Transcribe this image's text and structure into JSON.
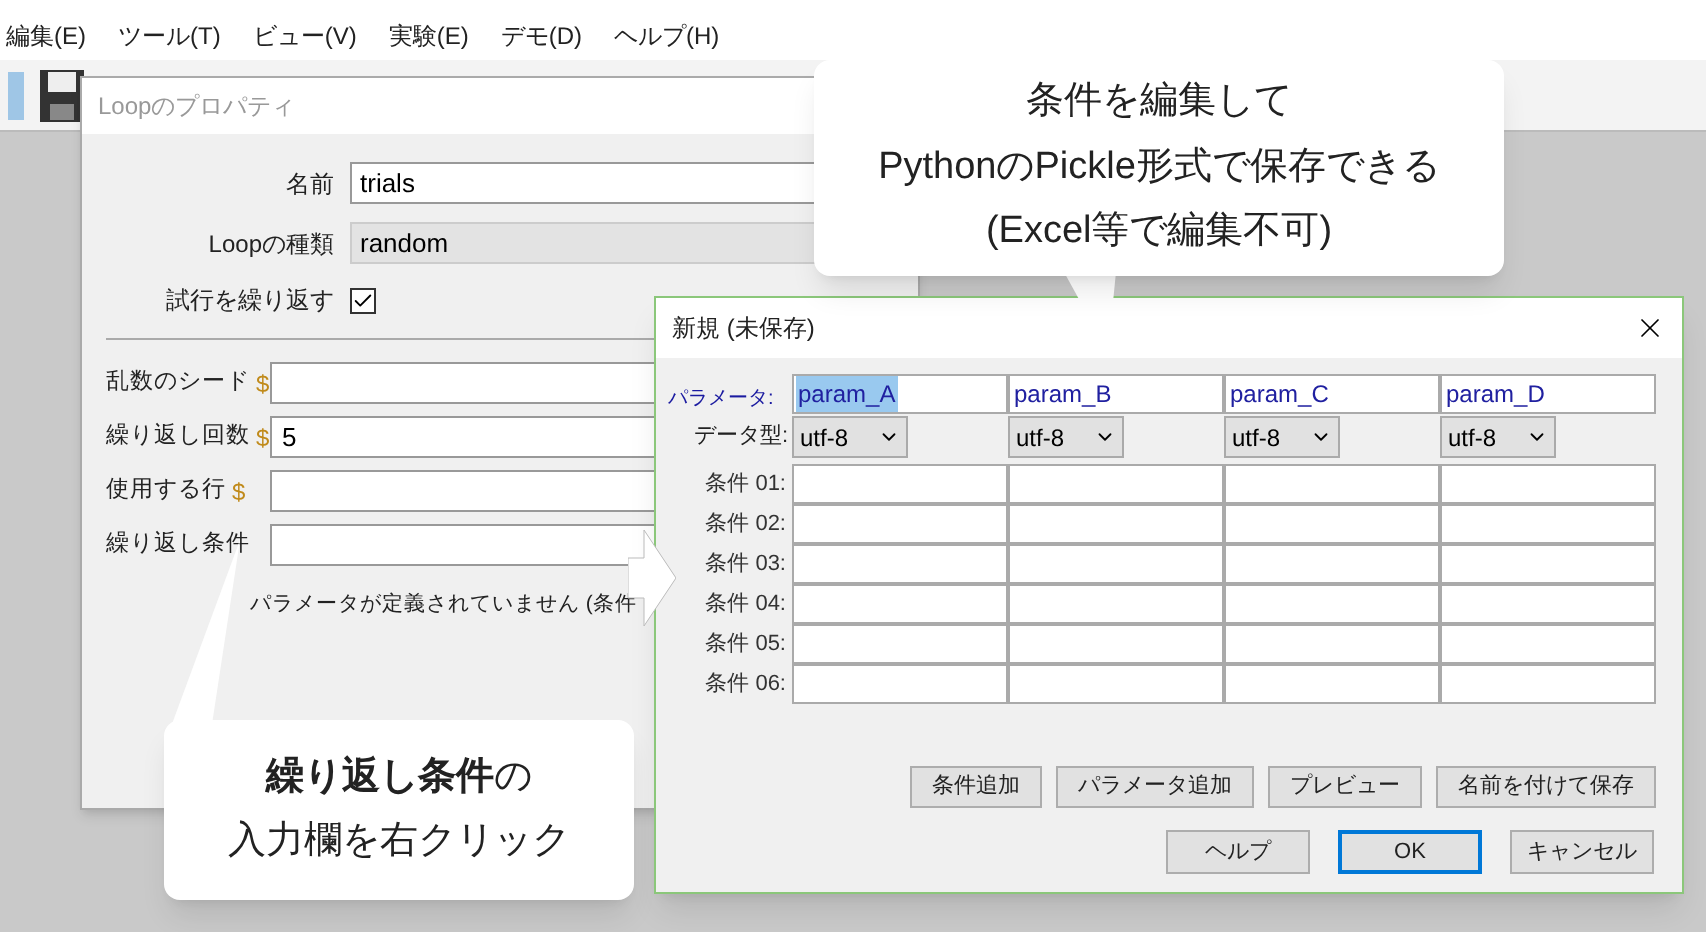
{
  "menu": [
    "編集(E)",
    "ツール(T)",
    "ビュー(V)",
    "実験(E)",
    "デモ(D)",
    "ヘルプ(H)"
  ],
  "loop_window": {
    "title": "Loopのプロパティ",
    "fields": [
      {
        "label": "名前",
        "value": "trials",
        "kind": "input"
      },
      {
        "label": "Loopの種類",
        "value": "random",
        "kind": "readonly"
      }
    ],
    "repeat": {
      "label": "試行を繰り返す",
      "checked": true
    },
    "advanced": [
      {
        "label": "乱数のシード",
        "marker": "$"
      },
      {
        "label": "繰り返し回数",
        "marker": "$",
        "value": "5"
      },
      {
        "label": "使用する行",
        "marker": "$"
      },
      {
        "label": "繰り返し条件"
      }
    ],
    "message": "パラメータが定義されていません (条件"
  },
  "callouts": [
    {
      "lines": [
        "**繰り返し条件**の",
        "入力欄を右クリック"
      ]
    },
    {
      "lines": [
        "条件を編集して",
        "PythonのPickle形式で保存できる",
        "(Excel等で編集不可)"
      ]
    }
  ],
  "dialog": {
    "title": "新規 (未保存)",
    "param_label": "パラメータ:",
    "dtype_label": "データ型:",
    "params": [
      {
        "name": "param_A",
        "selected": true,
        "dtype": "utf-8"
      },
      {
        "name": "param_B",
        "selected": false,
        "dtype": "utf-8"
      },
      {
        "name": "param_C",
        "selected": false,
        "dtype": "utf-8"
      },
      {
        "name": "param_D",
        "selected": false,
        "dtype": "utf-8"
      }
    ],
    "conditions": [
      "条件 01:",
      "条件 02:",
      "条件 03:",
      "条件 04:",
      "条件 05:",
      "条件 06:"
    ],
    "actions": [
      "条件追加",
      "パラメータ追加",
      "プレビュー",
      "名前を付けて保存"
    ],
    "buttons": [
      {
        "label": "ヘルプ",
        "default": false
      },
      {
        "label": "OK",
        "default": true
      },
      {
        "label": "キャンセル",
        "default": false
      }
    ]
  }
}
